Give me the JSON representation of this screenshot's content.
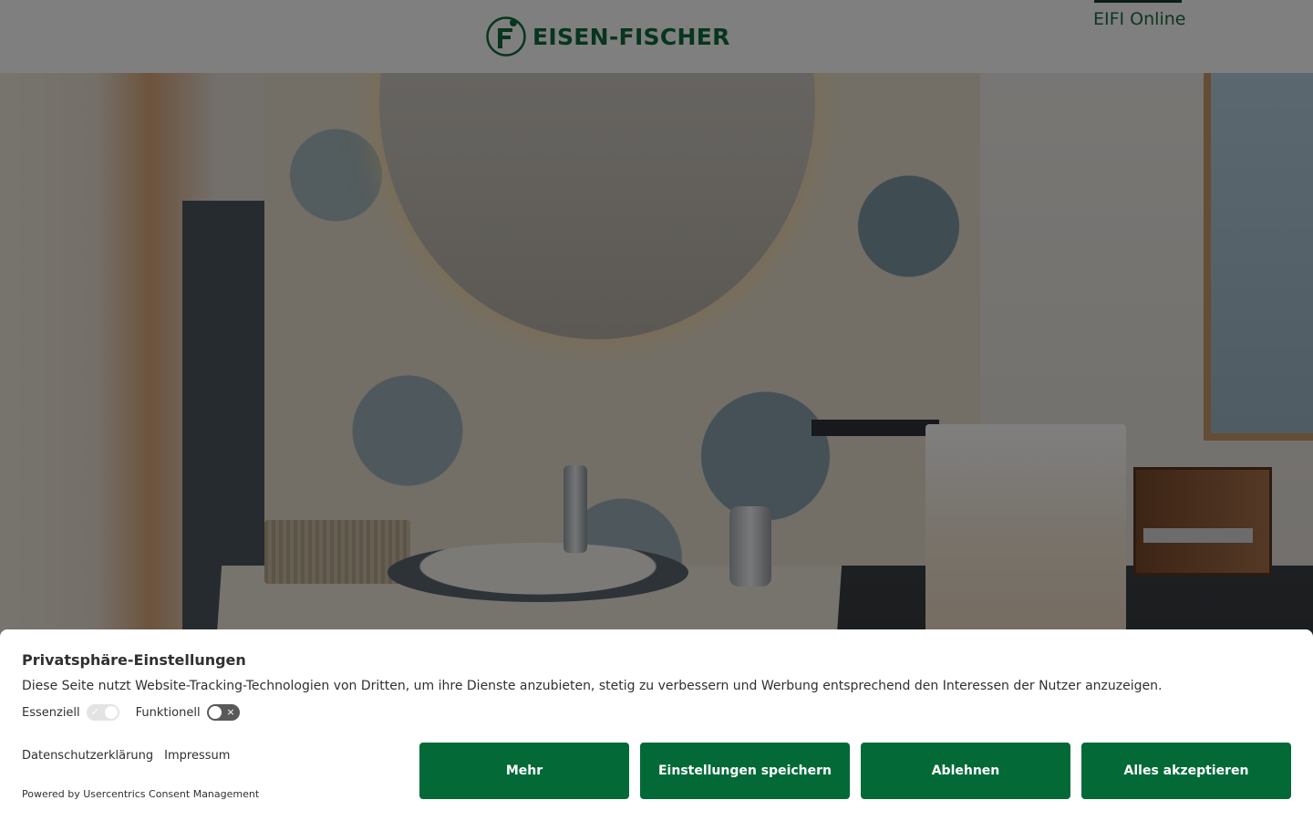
{
  "header": {
    "logo_text": "EISEN-FISCHER",
    "online_link": "EIFI Online",
    "brand_color": "#0f6b3a"
  },
  "hero": {
    "image": "bathroom-showroom-photo"
  },
  "consent": {
    "title": "Privatsphäre-Einstellungen",
    "description": "Diese Seite nutzt Website-Tracking-Technologien von Dritten, um ihre Dienste anzubieten, stetig zu verbessern und Werbung entsprechend den Interessen der Nutzer anzuzeigen.",
    "toggles": [
      {
        "label": "Essenziell",
        "state": "on",
        "disabled": true
      },
      {
        "label": "Funktionell",
        "state": "off",
        "disabled": false
      }
    ],
    "links": {
      "privacy": "Datenschutzerklärung",
      "imprint": "Impressum"
    },
    "powered_by": "Powered by Usercentrics Consent Management",
    "buttons": {
      "more": "Mehr",
      "save": "Einstellungen speichern",
      "decline": "Ablehnen",
      "accept_all": "Alles akzeptieren"
    },
    "button_color": "#036a37"
  }
}
